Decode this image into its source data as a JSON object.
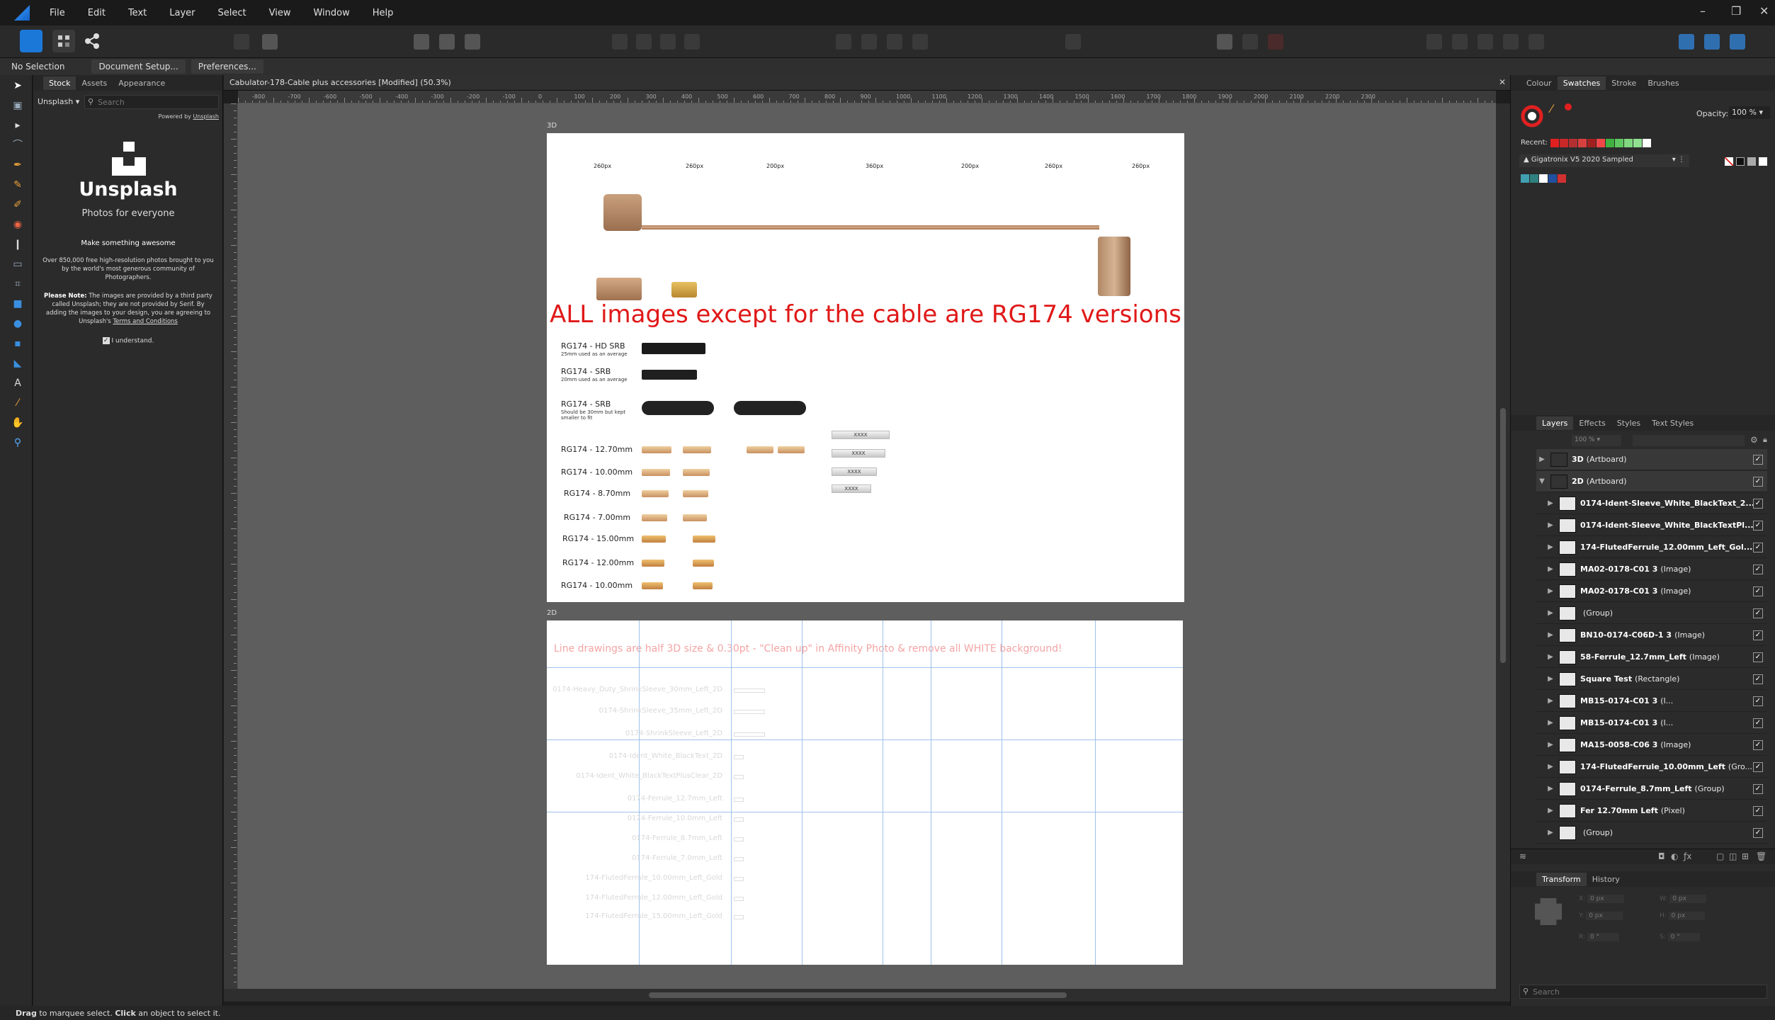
{
  "menu": [
    "File",
    "Edit",
    "Text",
    "Layer",
    "Select",
    "View",
    "Window",
    "Help"
  ],
  "context": {
    "selection": "No Selection",
    "document_setup": "Document Setup...",
    "preferences": "Preferences..."
  },
  "stock": {
    "tabs": [
      "Stock",
      "Assets",
      "Appearance"
    ],
    "provider": "Unsplash",
    "search_placeholder": "Search",
    "powered_by_prefix": "Powered by ",
    "powered_by_link": "Unsplash",
    "brand": "Unsplash",
    "tagline": "Photos for everyone",
    "heading": "Make something awesome",
    "description": "Over 850,000 free high-resolution photos brought to you by the world's most generous community of Photographers.",
    "note_label": "Please Note:",
    "note": "The images are provided by a third party called Unsplash; they are not provided by Serif. By adding the images to your design, you are agreeing to Unsplash's",
    "terms": "Terms and Conditions",
    "understand": "I understand."
  },
  "document": {
    "tab_title": "Cabulator-178-Cable plus accessories [Modified] (50.3%)",
    "ruler_labels": [
      "-800",
      "-700",
      "-600",
      "-500",
      "-400",
      "-300",
      "-200",
      "-100",
      "0",
      "100",
      "200",
      "300",
      "400",
      "500",
      "600",
      "700",
      "800",
      "900",
      "1000",
      "1100",
      "1200",
      "1300",
      "1400",
      "1500",
      "1600",
      "1700",
      "1800",
      "1900",
      "2000",
      "2100",
      "2200",
      "2300"
    ],
    "artboard_3d": {
      "label": "3D",
      "widths": [
        "260px",
        "260px",
        "200px",
        "360px",
        "200px",
        "260px",
        "260px"
      ],
      "banner": "ALL images except for the cable are RG174 versions",
      "sleeves": [
        {
          "title": "RG174 - HD SRB",
          "note": "25mm used as an average"
        },
        {
          "title": "RG174 - SRB",
          "note": "20mm used as an average"
        },
        {
          "title": "RG174 - SRB",
          "note": "Should be 30mm but kept smaller to fit"
        }
      ],
      "ferrules": [
        "RG174 - 12.70mm",
        "RG174 - 10.00mm",
        "RG174 - 8.70mm",
        "RG174 - 7.00mm",
        "RG174 - 15.00mm",
        "RG174 - 12.00mm",
        "RG174 - 10.00mm"
      ],
      "ident_text": "XXXX"
    },
    "artboard_2d": {
      "label": "2D",
      "banner": "Line drawings are half 3D size & 0.30pt - \"Clean up\" in Affinity Photo & remove all WHITE background!",
      "rows": [
        "0174-Heavy_Duty_ShrinkSleeve_30mm_Left_2D",
        "0174-ShrinkSleeve_35mm_Left_2D",
        "0174-ShrinkSleeve_Left_2D",
        "0174-Ident_White_BlackText_2D",
        "0174-Ident_White_BlackTextPlusClear_2D",
        "0174-Ferrule_12.7mm_Left",
        "0174-Ferrule_10.0mm_Left",
        "0174-Ferrule_8.7mm_Left",
        "0174-Ferrule_7.0mm_Left",
        "174-FlutedFerrule_10.00mm_Left_Gold",
        "174-FlutedFerrule_12.00mm_Left_Gold",
        "174-FlutedFerrule_15.00mm_Left_Gold"
      ]
    }
  },
  "right": {
    "top_tabs": [
      "Colour",
      "Swatches",
      "Stroke",
      "Brushes"
    ],
    "opacity_label": "Opacity:",
    "opacity_value": "100 %",
    "recent_label": "Recent:",
    "palette": "Gigatronix V5 2020 Sampled",
    "recent_colors": [
      "#e02020",
      "#c82828",
      "#b43030",
      "#d84040",
      "#a02020",
      "#f04848",
      "#40b040",
      "#60c860",
      "#80d880",
      "#90e090",
      "#ffffff"
    ],
    "palette_colors": [
      "#40a0b0",
      "#308080",
      "#ffffff",
      "#2050a0",
      "#d03030"
    ],
    "layer_tabs": [
      "Layers",
      "Effects",
      "Styles",
      "Text Styles"
    ],
    "layer_opacity": "100 %",
    "layers": [
      {
        "name": "3D",
        "kind": "(Artboard)"
      },
      {
        "name": "2D",
        "kind": "(Artboard)"
      },
      {
        "name": "0174-Ident-Sleeve_White_BlackText_2...",
        "kind": ""
      },
      {
        "name": "0174-Ident-Sleeve_White_BlackTextPl...",
        "kind": ""
      },
      {
        "name": "174-FlutedFerrule_12.00mm_Left_Gol...",
        "kind": ""
      },
      {
        "name": "MA02-0178-C01 3",
        "kind": "(Image)"
      },
      {
        "name": "MA02-0178-C01 3",
        "kind": "(Image)"
      },
      {
        "name": "",
        "kind": "(Group)"
      },
      {
        "name": "BN10-0174-C06D-1 3",
        "kind": "(Image)"
      },
      {
        "name": "58-Ferrule_12.7mm_Left",
        "kind": "(Image)"
      },
      {
        "name": "Square Test",
        "kind": "(Rectangle)"
      },
      {
        "name": "MB15-0174-C01 3",
        "kind": "(I..."
      },
      {
        "name": "MB15-0174-C01 3",
        "kind": "(I..."
      },
      {
        "name": "MA15-0058-C06 3",
        "kind": "(Image)"
      },
      {
        "name": "174-FlutedFerrule_10.00mm_Left",
        "kind": "(Gro..."
      },
      {
        "name": "0174-Ferrule_8.7mm_Left",
        "kind": "(Group)"
      },
      {
        "name": "Fer 12.70mm Left",
        "kind": "(Pixel)"
      },
      {
        "name": "",
        "kind": "(Group)"
      }
    ],
    "transform_tabs": [
      "Transform",
      "History"
    ],
    "transform": {
      "x": "0 px",
      "y": "0 px",
      "w": "0 px",
      "h": "0 px",
      "r": "0 °",
      "s": "0 °"
    },
    "search_placeholder": "Search"
  },
  "status": {
    "drag": "Drag",
    "drag_text": " to marquee select. ",
    "click": "Click",
    "click_text": " an object to select it."
  }
}
